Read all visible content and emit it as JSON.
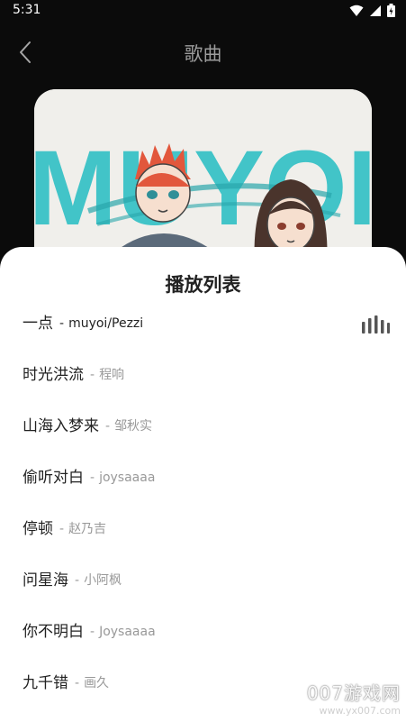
{
  "status_bar": {
    "time": "5:31"
  },
  "header": {
    "title": "歌曲"
  },
  "sheet": {
    "title": "播放列表"
  },
  "playlist": [
    {
      "name": "一点",
      "sep": "-",
      "artist": "muyoi/Pezzi",
      "active": true
    },
    {
      "name": "时光洪流",
      "sep": "-",
      "artist": "程响"
    },
    {
      "name": "山海入梦来",
      "sep": "-",
      "artist": "邹秋实"
    },
    {
      "name": "偷听对白",
      "sep": "-",
      "artist": "joysaaaa"
    },
    {
      "name": "停顿",
      "sep": "-",
      "artist": "赵乃吉"
    },
    {
      "name": "问星海",
      "sep": "-",
      "artist": "小阿枫"
    },
    {
      "name": "你不明白",
      "sep": "-",
      "artist": "Joysaaaa"
    },
    {
      "name": "九千错",
      "sep": "-",
      "artist": "画久"
    }
  ],
  "album_art": {
    "text": "MUYOI"
  },
  "watermark": {
    "line1": "007游戏网",
    "line2": "www.yx007.com"
  },
  "colors": {
    "background": "#0b0b0b",
    "sheet": "#ffffff",
    "accent_teal": "#3fc3c6"
  },
  "icons": [
    "back-arrow-icon",
    "wifi-icon",
    "signal-icon",
    "battery-icon",
    "playing-bars-icon"
  ]
}
